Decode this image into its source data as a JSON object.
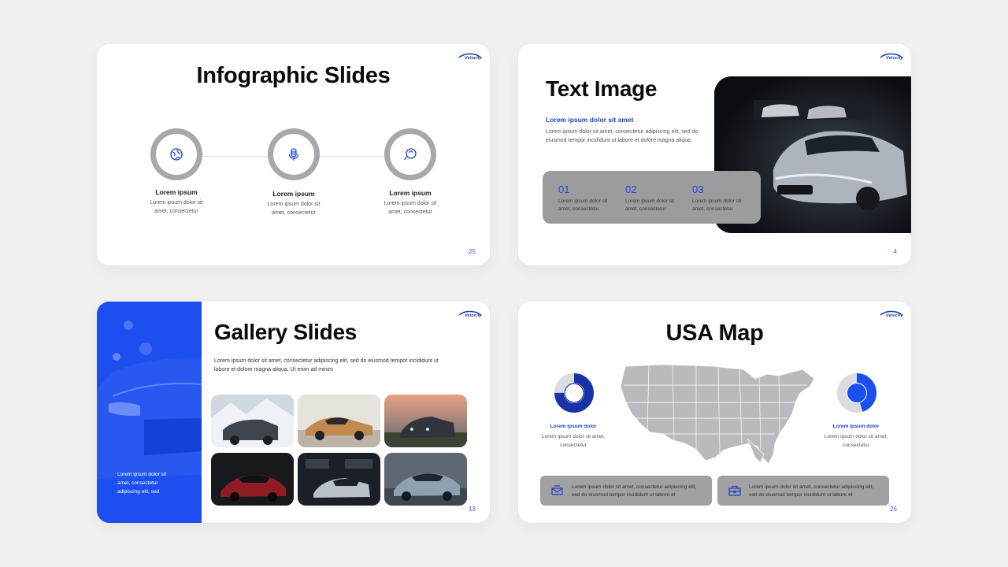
{
  "brand": {
    "logo_text": "Velocity",
    "accent": "#1c4ef0",
    "dark_blue": "#1e3a9e",
    "gray": "#a7a8ab"
  },
  "slides": [
    {
      "title": "Infographic Slides",
      "page": "25",
      "steps": [
        {
          "icon": "globe-icon",
          "label": "Lorem ipsum",
          "text": "Lorem ipsum dolor sit amet, consectetur"
        },
        {
          "icon": "microphone-icon",
          "label": "Lorem ipsum",
          "text": "Lorem ipsum dolor sit amet, consectetur"
        },
        {
          "icon": "lightbulb-icon",
          "label": "Lorem ipsum",
          "text": "Lorem ipsum dolor sit amet, consectetur"
        }
      ]
    },
    {
      "title": "Text Image",
      "page": "4",
      "subtitle": "Lorem ipsum dolor sit amet",
      "description": "Lorem ipsum dolor sit amet, consectetur adipiscing elit, sed do eiusmod tempor incididunt ut labore et dolore magna aliqua.",
      "items": [
        {
          "num": "01",
          "text": "Lorem ipsum dolor sit amet, consectetur"
        },
        {
          "num": "02",
          "text": "Lorem ipsum dolor sit amet, consectetur"
        },
        {
          "num": "03",
          "text": "Lorem ipsum dolor sit amet, consectetur"
        }
      ]
    },
    {
      "title": "Gallery Slides",
      "page": "13",
      "description": "Lorem ipsum dolor sit amet, consectetur adipiscing elit, sed do eiusmod tempor incididunt ut labore et dolore magna aliqua. Ut enim ad minim",
      "panel_text": "Lorem ipsum dolor sit amet, consectetur adipiscing elit, sed"
    },
    {
      "title": "USA Map",
      "page": "26",
      "left": {
        "label": "Lorem ipsum dolor",
        "text": "Lorem ipsum dolor sit amet, consectetur",
        "percent": 75
      },
      "right": {
        "label": "Lorem ipsum dolor",
        "text": "Lorem ipsum dolor sit amet, consectetur",
        "percent": 45
      },
      "boxes": [
        {
          "icon": "mail-icon",
          "text": "Lorem ipsum dolor sit amet, consectetur adipiscing elit, sed do eiusmod tempor incididunt ut labore et"
        },
        {
          "icon": "briefcase-icon",
          "text": "Lorem ipsum dolor sit amet, consectetur adipiscing elit, sed do eiusmod tempor incididunt ut labore et"
        }
      ]
    }
  ]
}
